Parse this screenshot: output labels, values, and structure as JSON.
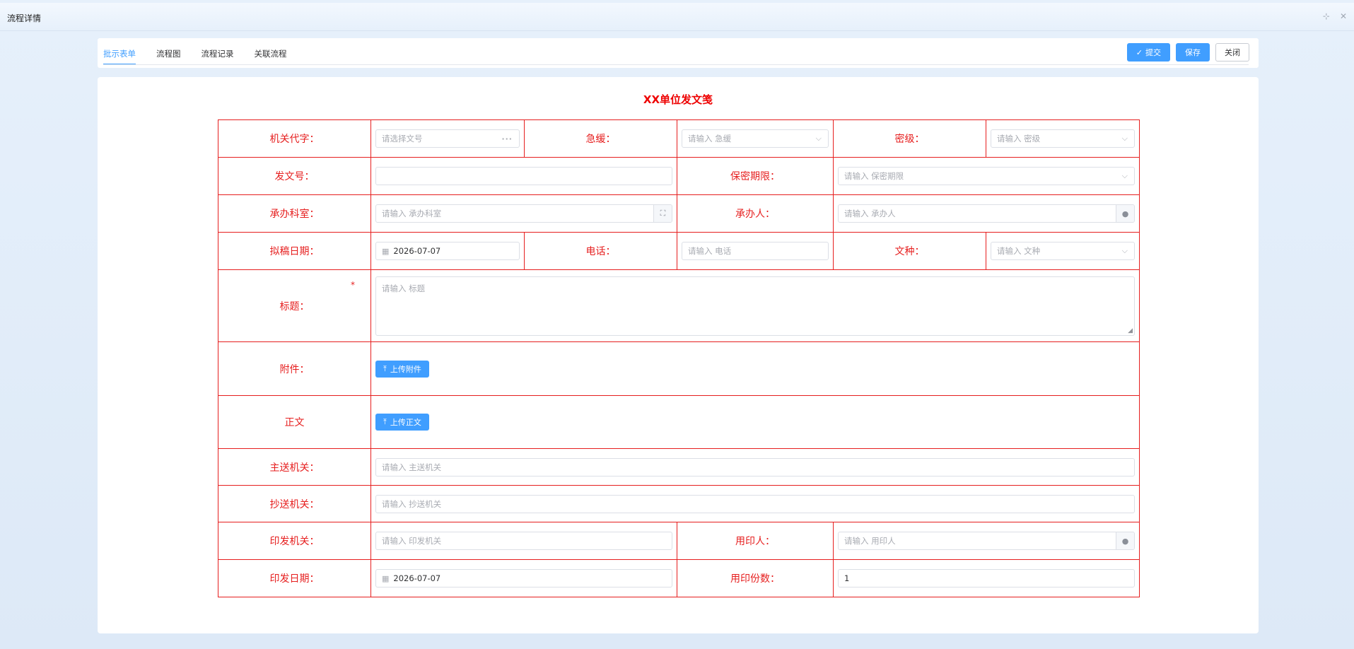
{
  "window": {
    "title": "流程详情"
  },
  "tabs": [
    {
      "label": "批示表单",
      "active": true
    },
    {
      "label": "流程图"
    },
    {
      "label": "流程记录"
    },
    {
      "label": "关联流程"
    }
  ],
  "actions": {
    "submit": "提交",
    "save": "保存",
    "close": "关闭"
  },
  "form": {
    "title": "XX单位发文笺",
    "required_mark": "*",
    "fields": {
      "agency_code": {
        "label": "机关代字：",
        "placeholder": "请选择文号"
      },
      "urgency": {
        "label": "急缓：",
        "placeholder": "请输入 急缓"
      },
      "secrecy": {
        "label": "密级：",
        "placeholder": "请输入 密级"
      },
      "doc_number": {
        "label": "发文号：",
        "value": ""
      },
      "secrecy_period": {
        "label": "保密期限：",
        "placeholder": "请输入 保密期限"
      },
      "dept": {
        "label": "承办科室：",
        "placeholder": "请输入 承办科室"
      },
      "handler": {
        "label": "承办人：",
        "placeholder": "请输入 承办人"
      },
      "draft_date": {
        "label": "拟稿日期：",
        "value": "2026-07-07"
      },
      "phone": {
        "label": "电话：",
        "placeholder": "请输入 电话"
      },
      "doc_type": {
        "label": "文种：",
        "placeholder": "请输入 文种"
      },
      "subject": {
        "label": "标题：",
        "placeholder": "请输入 标题"
      },
      "attachment": {
        "label": "附件：",
        "button": "上传附件"
      },
      "body": {
        "label": "正文",
        "button": "上传正文"
      },
      "main_recipient": {
        "label": "主送机关：",
        "placeholder": "请输入 主送机关"
      },
      "cc_recipient": {
        "label": "抄送机关：",
        "placeholder": "请输入 抄送机关"
      },
      "issuing_org": {
        "label": "印发机关：",
        "placeholder": "请输入 印发机关"
      },
      "sealer": {
        "label": "用印人：",
        "placeholder": "请输入 用印人"
      },
      "issue_date": {
        "label": "印发日期：",
        "value": "2026-07-07"
      },
      "copies": {
        "label": "用印份数：",
        "value": "1"
      }
    }
  },
  "colors": {
    "accent": "#409eff",
    "form_red": "#e61e1e"
  }
}
